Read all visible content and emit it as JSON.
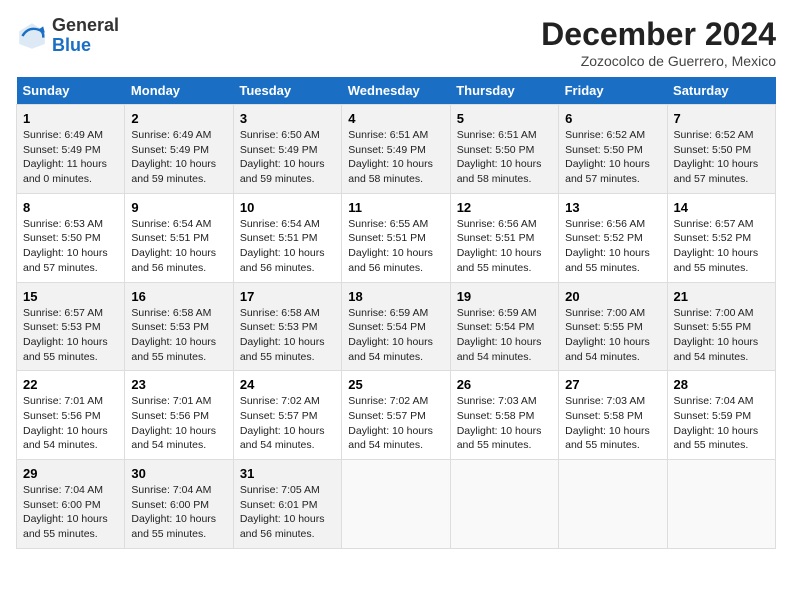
{
  "header": {
    "logo_general": "General",
    "logo_blue": "Blue",
    "title": "December 2024",
    "subtitle": "Zozocolco de Guerrero, Mexico"
  },
  "days_of_week": [
    "Sunday",
    "Monday",
    "Tuesday",
    "Wednesday",
    "Thursday",
    "Friday",
    "Saturday"
  ],
  "weeks": [
    [
      {
        "day": "1",
        "sunrise": "6:49 AM",
        "sunset": "5:49 PM",
        "daylight": "11 hours and 0 minutes."
      },
      {
        "day": "2",
        "sunrise": "6:49 AM",
        "sunset": "5:49 PM",
        "daylight": "10 hours and 59 minutes."
      },
      {
        "day": "3",
        "sunrise": "6:50 AM",
        "sunset": "5:49 PM",
        "daylight": "10 hours and 59 minutes."
      },
      {
        "day": "4",
        "sunrise": "6:51 AM",
        "sunset": "5:49 PM",
        "daylight": "10 hours and 58 minutes."
      },
      {
        "day": "5",
        "sunrise": "6:51 AM",
        "sunset": "5:50 PM",
        "daylight": "10 hours and 58 minutes."
      },
      {
        "day": "6",
        "sunrise": "6:52 AM",
        "sunset": "5:50 PM",
        "daylight": "10 hours and 57 minutes."
      },
      {
        "day": "7",
        "sunrise": "6:52 AM",
        "sunset": "5:50 PM",
        "daylight": "10 hours and 57 minutes."
      }
    ],
    [
      {
        "day": "8",
        "sunrise": "6:53 AM",
        "sunset": "5:50 PM",
        "daylight": "10 hours and 57 minutes."
      },
      {
        "day": "9",
        "sunrise": "6:54 AM",
        "sunset": "5:51 PM",
        "daylight": "10 hours and 56 minutes."
      },
      {
        "day": "10",
        "sunrise": "6:54 AM",
        "sunset": "5:51 PM",
        "daylight": "10 hours and 56 minutes."
      },
      {
        "day": "11",
        "sunrise": "6:55 AM",
        "sunset": "5:51 PM",
        "daylight": "10 hours and 56 minutes."
      },
      {
        "day": "12",
        "sunrise": "6:56 AM",
        "sunset": "5:51 PM",
        "daylight": "10 hours and 55 minutes."
      },
      {
        "day": "13",
        "sunrise": "6:56 AM",
        "sunset": "5:52 PM",
        "daylight": "10 hours and 55 minutes."
      },
      {
        "day": "14",
        "sunrise": "6:57 AM",
        "sunset": "5:52 PM",
        "daylight": "10 hours and 55 minutes."
      }
    ],
    [
      {
        "day": "15",
        "sunrise": "6:57 AM",
        "sunset": "5:53 PM",
        "daylight": "10 hours and 55 minutes."
      },
      {
        "day": "16",
        "sunrise": "6:58 AM",
        "sunset": "5:53 PM",
        "daylight": "10 hours and 55 minutes."
      },
      {
        "day": "17",
        "sunrise": "6:58 AM",
        "sunset": "5:53 PM",
        "daylight": "10 hours and 55 minutes."
      },
      {
        "day": "18",
        "sunrise": "6:59 AM",
        "sunset": "5:54 PM",
        "daylight": "10 hours and 54 minutes."
      },
      {
        "day": "19",
        "sunrise": "6:59 AM",
        "sunset": "5:54 PM",
        "daylight": "10 hours and 54 minutes."
      },
      {
        "day": "20",
        "sunrise": "7:00 AM",
        "sunset": "5:55 PM",
        "daylight": "10 hours and 54 minutes."
      },
      {
        "day": "21",
        "sunrise": "7:00 AM",
        "sunset": "5:55 PM",
        "daylight": "10 hours and 54 minutes."
      }
    ],
    [
      {
        "day": "22",
        "sunrise": "7:01 AM",
        "sunset": "5:56 PM",
        "daylight": "10 hours and 54 minutes."
      },
      {
        "day": "23",
        "sunrise": "7:01 AM",
        "sunset": "5:56 PM",
        "daylight": "10 hours and 54 minutes."
      },
      {
        "day": "24",
        "sunrise": "7:02 AM",
        "sunset": "5:57 PM",
        "daylight": "10 hours and 54 minutes."
      },
      {
        "day": "25",
        "sunrise": "7:02 AM",
        "sunset": "5:57 PM",
        "daylight": "10 hours and 54 minutes."
      },
      {
        "day": "26",
        "sunrise": "7:03 AM",
        "sunset": "5:58 PM",
        "daylight": "10 hours and 55 minutes."
      },
      {
        "day": "27",
        "sunrise": "7:03 AM",
        "sunset": "5:58 PM",
        "daylight": "10 hours and 55 minutes."
      },
      {
        "day": "28",
        "sunrise": "7:04 AM",
        "sunset": "5:59 PM",
        "daylight": "10 hours and 55 minutes."
      }
    ],
    [
      {
        "day": "29",
        "sunrise": "7:04 AM",
        "sunset": "6:00 PM",
        "daylight": "10 hours and 55 minutes."
      },
      {
        "day": "30",
        "sunrise": "7:04 AM",
        "sunset": "6:00 PM",
        "daylight": "10 hours and 55 minutes."
      },
      {
        "day": "31",
        "sunrise": "7:05 AM",
        "sunset": "6:01 PM",
        "daylight": "10 hours and 56 minutes."
      },
      null,
      null,
      null,
      null
    ]
  ]
}
